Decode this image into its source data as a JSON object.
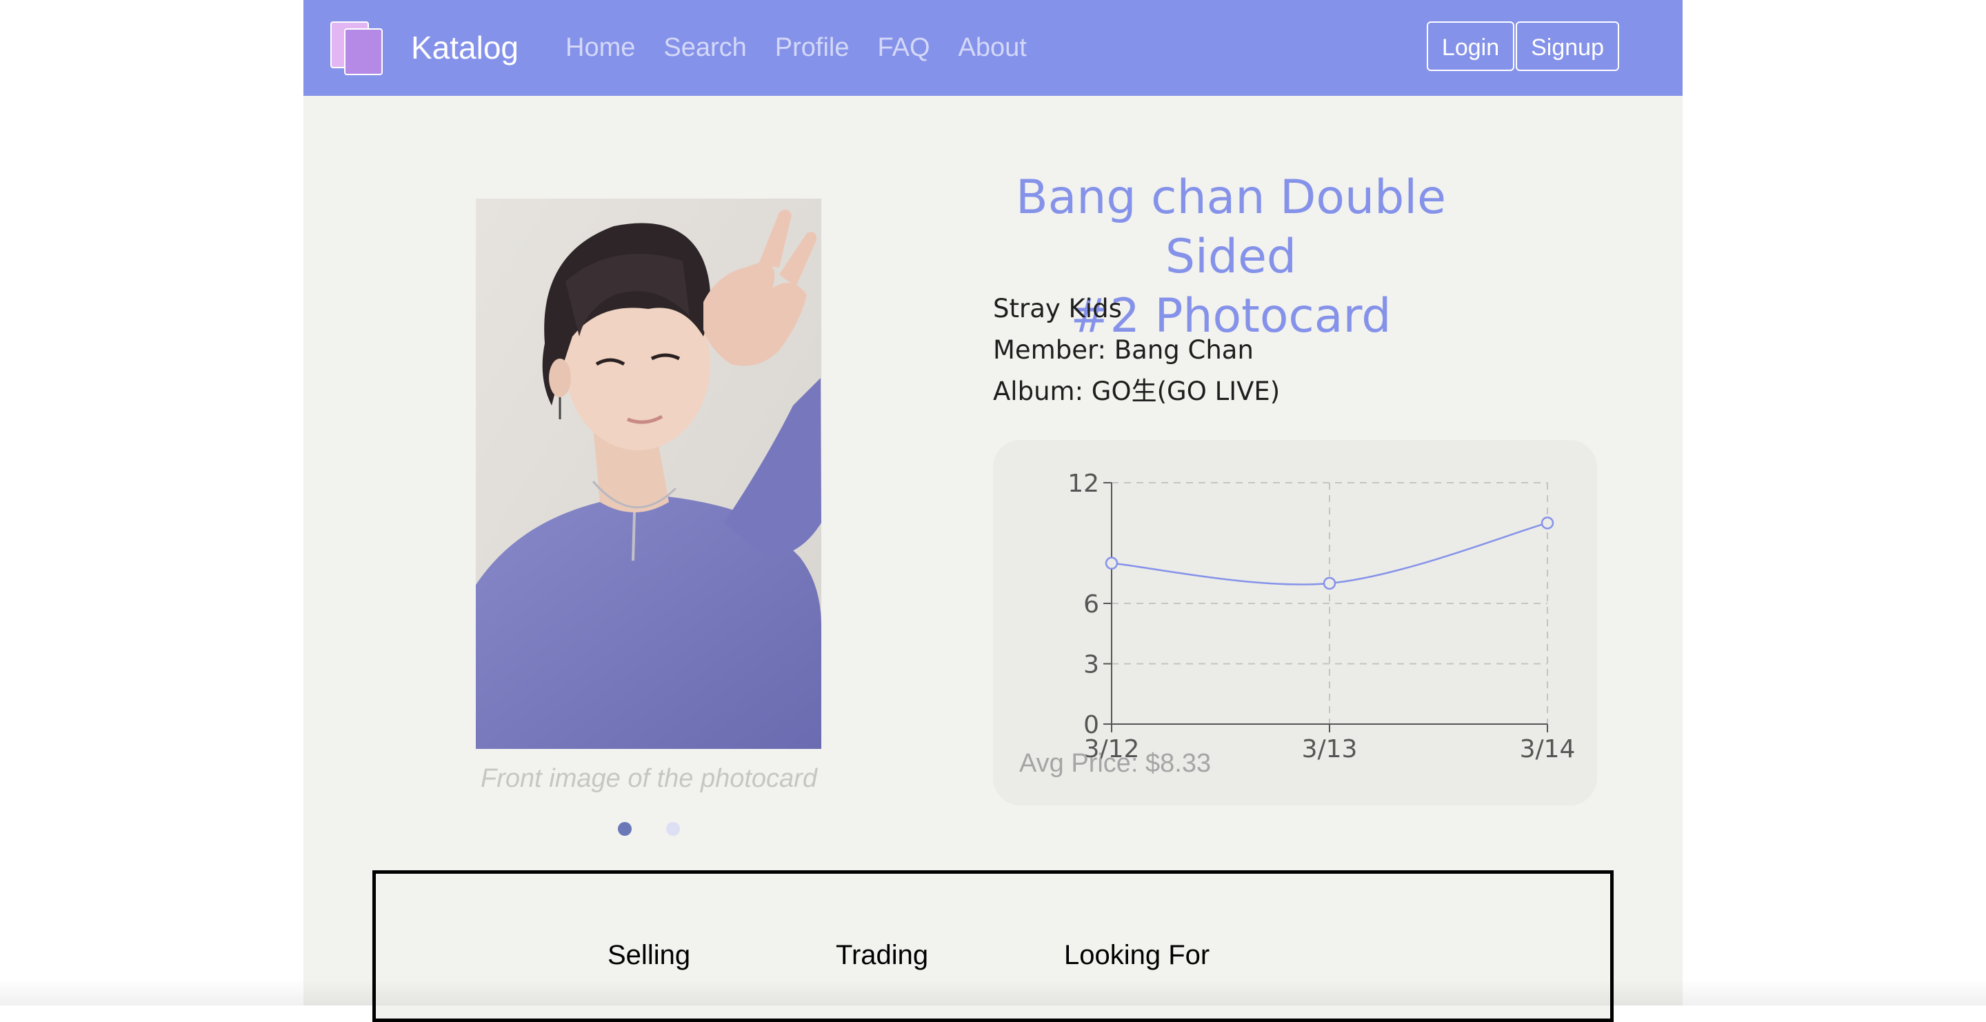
{
  "navbar": {
    "brand": "Katalog",
    "links": [
      "Home",
      "Search",
      "Profile",
      "FAQ",
      "About"
    ],
    "login_label": "Login",
    "signup_label": "Signup",
    "color": "#8592e9"
  },
  "product": {
    "title_line1": "Bang chan Double Sided",
    "title_line2": "#2 Photocard",
    "group": "Stray Kids",
    "member": "Member: Bang Chan",
    "album": "Album: GO生(GO LIVE)",
    "image_caption": "Front image of the photocard",
    "carousel_count": 2,
    "carousel_active": 0
  },
  "price_chart": {
    "avg_price": "Avg Price: $8.33"
  },
  "chart_data": {
    "type": "line",
    "categories": [
      "3/12",
      "3/13",
      "3/14"
    ],
    "values": [
      8,
      7,
      10
    ],
    "yticks": [
      0,
      3,
      6,
      12
    ],
    "ylim": [
      0,
      12
    ],
    "line_color": "#8592e9",
    "grid": true
  },
  "listings": {
    "tabs": [
      "Selling",
      "Trading",
      "Looking For"
    ]
  }
}
